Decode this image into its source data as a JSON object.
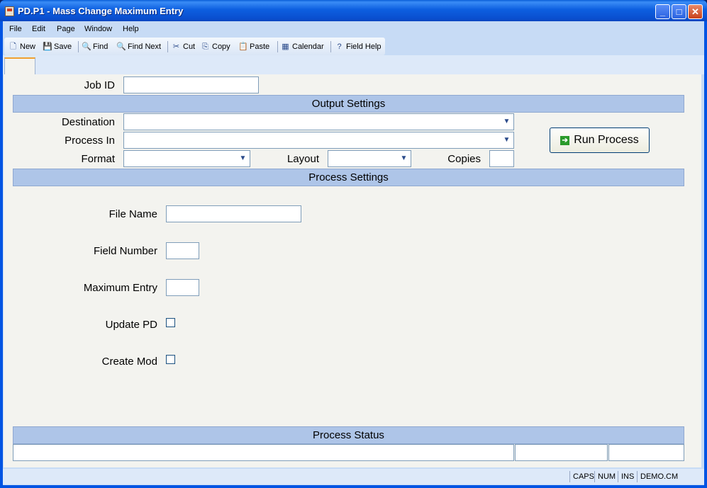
{
  "window": {
    "title": "PD.P1 - Mass Change Maximum Entry",
    "minimize": "_",
    "maximize": "□",
    "close": "✕"
  },
  "menu": {
    "file": "File",
    "edit": "Edit",
    "page": "Page",
    "window": "Window",
    "help": "Help"
  },
  "toolbar": {
    "new": "New",
    "save": "Save",
    "find": "Find",
    "find_next": "Find Next",
    "cut": "Cut",
    "copy": "Copy",
    "paste": "Paste",
    "calendar": "Calendar",
    "field_help": "Field Help"
  },
  "form": {
    "job_id_label": "Job ID",
    "job_id_value": "",
    "output_settings": "Output Settings",
    "destination_label": "Destination",
    "destination_value": "",
    "process_in_label": "Process In",
    "process_in_value": "",
    "format_label": "Format",
    "format_value": "",
    "layout_label": "Layout",
    "layout_value": "",
    "copies_label": "Copies",
    "copies_value": "",
    "run_process": "Run Process",
    "process_settings": "Process Settings",
    "file_name_label": "File Name",
    "file_name_value": "",
    "field_number_label": "Field Number",
    "field_number_value": "",
    "maximum_entry_label": "Maximum Entry",
    "maximum_entry_value": "",
    "update_pd_label": "Update PD",
    "update_pd_checked": false,
    "create_mod_label": "Create Mod",
    "create_mod_checked": false,
    "process_status": "Process Status"
  },
  "statusbar": {
    "caps": "CAPS",
    "num": "NUM",
    "ins": "INS",
    "account": "DEMO.CM"
  }
}
